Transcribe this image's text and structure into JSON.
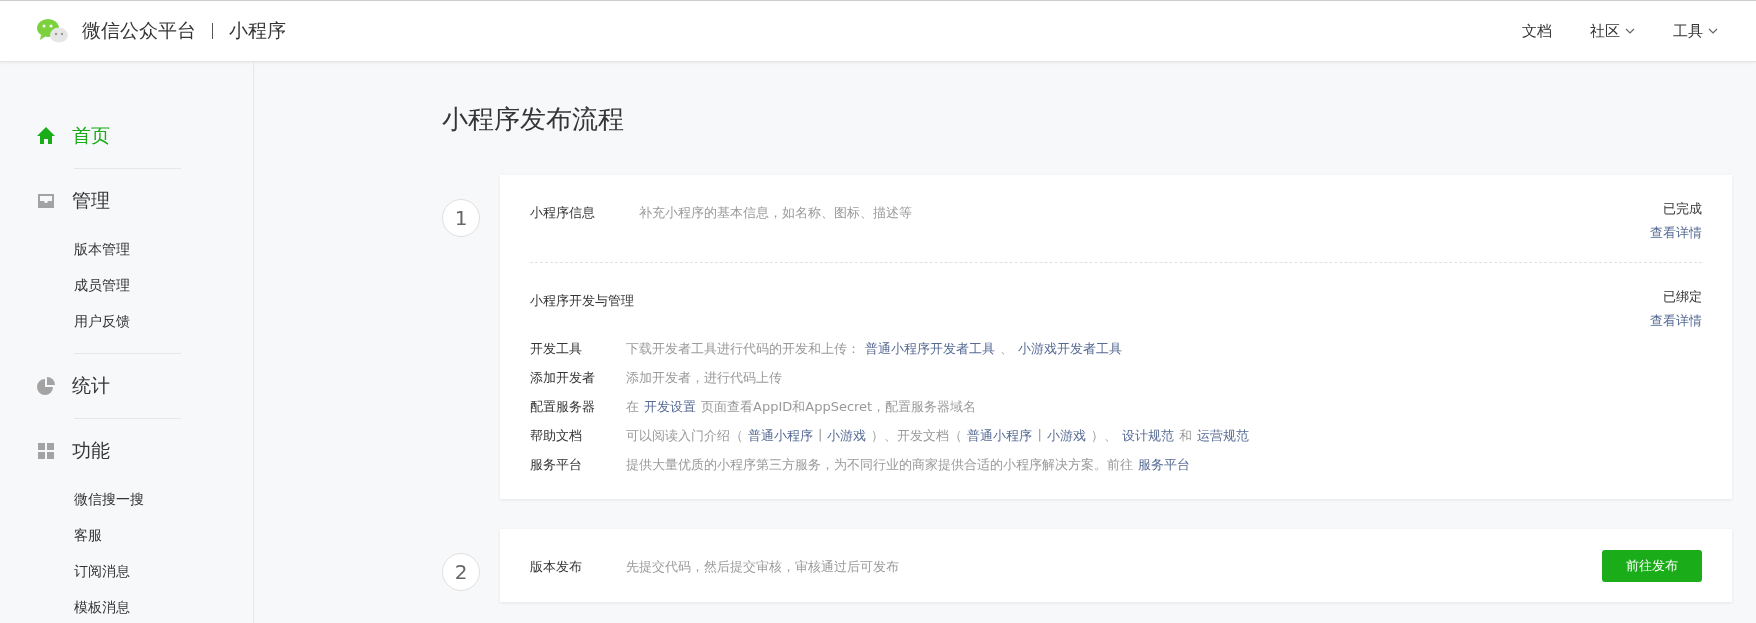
{
  "header": {
    "brand": "微信公众平台",
    "product": "小程序",
    "nav": [
      {
        "label": "文档",
        "dropdown": false
      },
      {
        "label": "社区",
        "dropdown": true
      },
      {
        "label": "工具",
        "dropdown": true
      }
    ]
  },
  "sidebar": {
    "groups": [
      {
        "label": "首页",
        "selected": true
      },
      {
        "label": "管理",
        "selected": false,
        "items": [
          "版本管理",
          "成员管理",
          "用户反馈"
        ]
      },
      {
        "label": "统计",
        "selected": false
      },
      {
        "label": "功能",
        "selected": false,
        "items": [
          "微信搜一搜",
          "客服",
          "订阅消息",
          "模板消息"
        ]
      }
    ]
  },
  "page_title": "小程序发布流程",
  "steps": [
    {
      "number": "1",
      "sections": [
        {
          "title": "小程序信息",
          "desc": "补充小程序的基本信息，如名称、图标、描述等",
          "status": "已完成",
          "link": "查看详情"
        },
        {
          "title": "小程序开发与管理",
          "status": "已绑定",
          "link": "查看详情",
          "rows": [
            {
              "label": "开发工具",
              "parts": [
                {
                  "kind": "text",
                  "text": "下载开发者工具进行代码的开发和上传："
                },
                {
                  "kind": "link",
                  "text": "普通小程序开发者工具"
                },
                {
                  "kind": "text",
                  "text": "、"
                },
                {
                  "kind": "link",
                  "text": "小游戏开发者工具"
                }
              ]
            },
            {
              "label": "添加开发者",
              "parts": [
                {
                  "kind": "text",
                  "text": "添加开发者，进行代码上传"
                }
              ]
            },
            {
              "label": "配置服务器",
              "parts": [
                {
                  "kind": "text",
                  "text": "在"
                },
                {
                  "kind": "link",
                  "text": "开发设置"
                },
                {
                  "kind": "text",
                  "text": "页面查看AppID和AppSecret，配置服务器域名"
                }
              ]
            },
            {
              "label": "帮助文档",
              "parts": [
                {
                  "kind": "text",
                  "text": "可以阅读入门介绍（"
                },
                {
                  "kind": "link",
                  "text": "普通小程序"
                },
                {
                  "kind": "text",
                  "text": "|"
                },
                {
                  "kind": "link",
                  "text": "小游戏"
                },
                {
                  "kind": "text",
                  "text": "）、开发文档（"
                },
                {
                  "kind": "link",
                  "text": "普通小程序"
                },
                {
                  "kind": "text",
                  "text": "|"
                },
                {
                  "kind": "link",
                  "text": "小游戏"
                },
                {
                  "kind": "text",
                  "text": "）、"
                },
                {
                  "kind": "link",
                  "text": "设计规范"
                },
                {
                  "kind": "text",
                  "text": "和"
                },
                {
                  "kind": "link",
                  "text": "运营规范"
                }
              ]
            },
            {
              "label": "服务平台",
              "parts": [
                {
                  "kind": "text",
                  "text": "提供大量优质的小程序第三方服务，为不同行业的商家提供合适的小程序解决方案。前往"
                },
                {
                  "kind": "link",
                  "text": "服务平台"
                }
              ]
            }
          ]
        }
      ]
    },
    {
      "number": "2",
      "sections": [
        {
          "title": "版本发布",
          "desc": "先提交代码，然后提交审核，审核通过后可发布",
          "button": "前往发布"
        }
      ]
    }
  ]
}
